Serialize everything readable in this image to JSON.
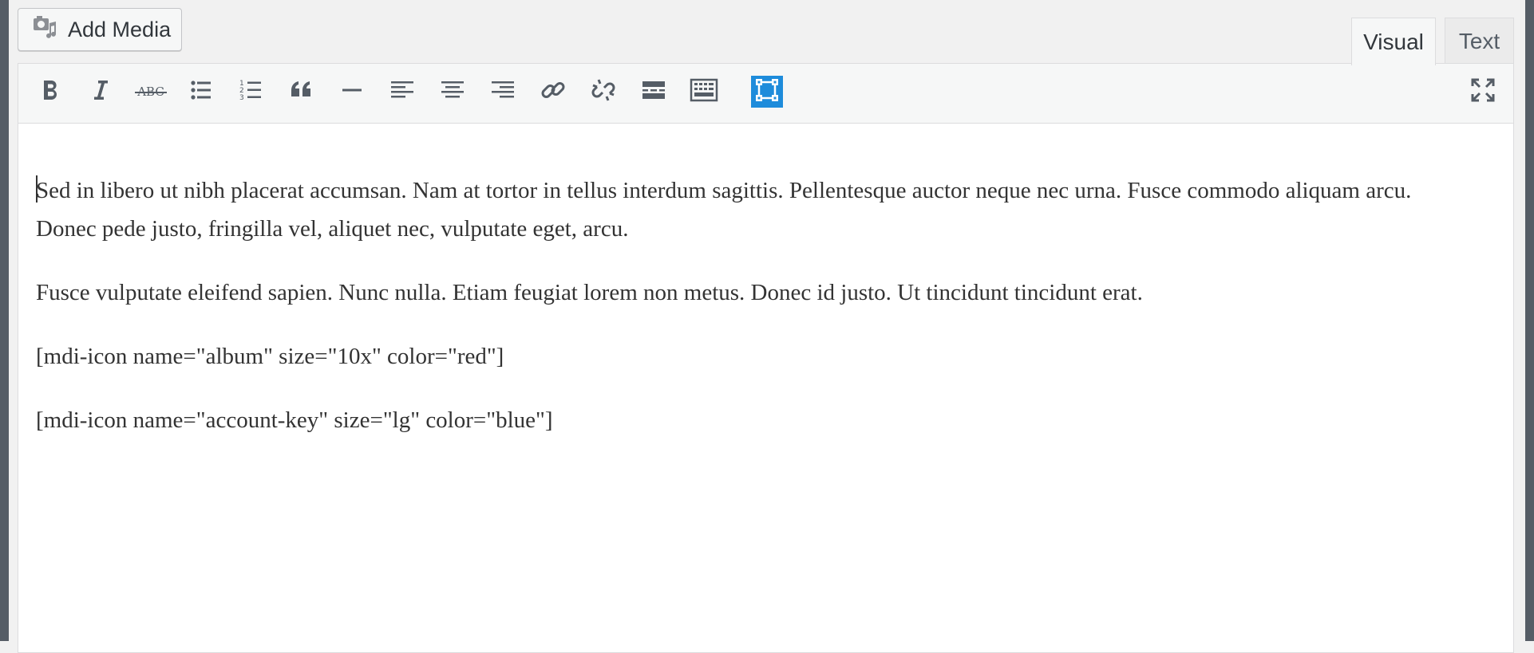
{
  "toolbar": {
    "add_media_label": "Add Media",
    "abc_label": "ABC"
  },
  "tabs": [
    {
      "label": "Visual",
      "active": true
    },
    {
      "label": "Text",
      "active": false
    }
  ],
  "content": {
    "paragraphs": [
      "Sed in libero ut nibh placerat accumsan. Nam at tortor in tellus interdum sagittis. Pellentesque auctor neque nec urna. Fusce commodo aliquam arcu. Donec pede justo, fringilla vel, aliquet nec, vulputate eget, arcu.",
      "Fusce vulputate eleifend sapien. Nunc nulla. Etiam feugiat lorem non metus. Donec id justo. Ut tincidunt tincidunt erat.",
      "[mdi-icon name=\"album\" size=\"10x\" color=\"red\"]",
      "[mdi-icon name=\"account-key\" size=\"lg\" color=\"blue\"]"
    ]
  },
  "colors": {
    "accent": "#1e8cdb",
    "icon": "#555d66",
    "text": "#333333"
  },
  "icons": [
    "add-media-icon",
    "bold-icon",
    "italic-icon",
    "strikethrough-icon",
    "bullet-list-icon",
    "numbered-list-icon",
    "blockquote-icon",
    "horizontal-rule-icon",
    "align-left-icon",
    "align-center-icon",
    "align-right-icon",
    "link-icon",
    "unlink-icon",
    "read-more-icon",
    "toolbar-toggle-icon",
    "mdi-icon-button-icon",
    "fullscreen-icon"
  ]
}
